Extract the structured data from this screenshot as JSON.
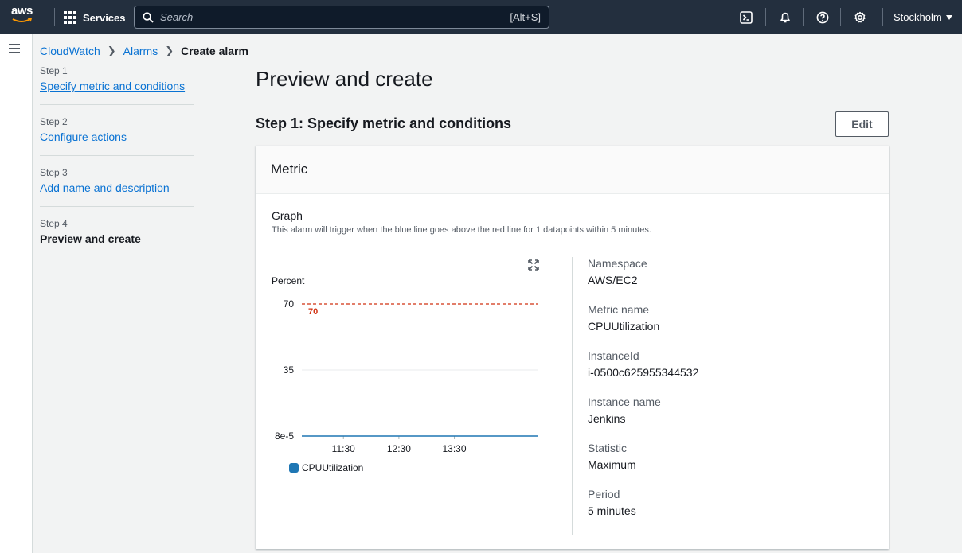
{
  "topnav": {
    "logo": "aws",
    "services_label": "Services",
    "search_placeholder": "Search",
    "search_shortcut": "[Alt+S]",
    "region": "Stockholm",
    "icons": [
      "cloudshell-icon",
      "notifications-icon",
      "help-icon",
      "settings-icon"
    ]
  },
  "breadcrumb": {
    "items": [
      "CloudWatch",
      "Alarms"
    ],
    "current": "Create alarm"
  },
  "steps": [
    {
      "number": "Step 1",
      "label": "Specify metric and conditions"
    },
    {
      "number": "Step 2",
      "label": "Configure actions"
    },
    {
      "number": "Step 3",
      "label": "Add name and description"
    },
    {
      "number": "Step 4",
      "label": "Preview and create"
    }
  ],
  "page": {
    "title": "Preview and create",
    "section_title": "Step 1: Specify metric and conditions",
    "edit_label": "Edit"
  },
  "metric_card": {
    "header": "Metric",
    "graph_label": "Graph",
    "graph_description": "This alarm will trigger when the blue line goes above the red line for 1 datapoints within 5 minutes."
  },
  "chart_data": {
    "type": "line",
    "ylabel": "Percent",
    "y_ticks": [
      "70",
      "35",
      "8e-5"
    ],
    "y_tick_values": [
      70,
      35,
      8e-05
    ],
    "ylim": [
      8e-05,
      70
    ],
    "x_ticks": [
      "11:30",
      "12:30",
      "13:30"
    ],
    "threshold": {
      "value": 70,
      "label": "70",
      "color": "#d13212"
    },
    "series": [
      {
        "name": "CPUUtilization",
        "color": "#1f77b4",
        "segments": [
          [
            [
              "10:45",
              8e-05
            ],
            [
              "10:50",
              8e-05
            ],
            [
              "10:55",
              8e-05
            ],
            [
              "11:00",
              8e-05
            ],
            [
              "11:05",
              8e-05
            ],
            [
              "11:10",
              8e-05
            ],
            [
              "11:15",
              8e-05
            ],
            [
              "11:20",
              8e-05
            ],
            [
              "11:25",
              8e-05
            ],
            [
              "11:30",
              8e-05
            ],
            [
              "11:35",
              8e-05
            ],
            [
              "11:40",
              8e-05
            ],
            [
              "11:45",
              8e-05
            ],
            [
              "11:50",
              8e-05
            ],
            [
              "11:55",
              8e-05
            ],
            [
              "12:00",
              8e-05
            ],
            [
              "12:05",
              8e-05
            ],
            [
              "12:10",
              8e-05
            ],
            [
              "12:15",
              8e-05
            ],
            [
              "12:20",
              8e-05
            ],
            [
              "12:25",
              8e-05
            ],
            [
              "12:30",
              8e-05
            ],
            [
              "12:35",
              8e-05
            ],
            [
              "12:40",
              8e-05
            ],
            [
              "12:45",
              8e-05
            ],
            [
              "12:50",
              8e-05
            ],
            [
              "12:55",
              8e-05
            ],
            [
              "13:00",
              8e-05
            ],
            [
              "13:05",
              8e-05
            ],
            [
              "13:10",
              8e-05
            ],
            [
              "13:15",
              8e-05
            ],
            [
              "13:20",
              8e-05
            ],
            [
              "13:25",
              8e-05
            ],
            [
              "13:30",
              8e-05
            ],
            [
              "13:35",
              8e-05
            ],
            [
              "13:40",
              8e-05
            ],
            [
              "13:45",
              8e-05
            ],
            [
              "13:50",
              8e-05
            ],
            [
              "13:55",
              8e-05
            ],
            [
              "14:00",
              8e-05
            ],
            [
              "14:05",
              8e-05
            ],
            [
              "14:10",
              8e-05
            ],
            [
              "14:15",
              8e-05
            ],
            [
              "14:20",
              8e-05
            ],
            [
              "14:25",
              8e-05
            ],
            [
              "14:30",
              8e-05
            ],
            [
              "14:35",
              8e-05
            ],
            [
              "14:40",
              8e-05
            ],
            [
              "14:45",
              8e-05
            ],
            [
              "14:50",
              8e-05
            ],
            [
              "14:55",
              8e-05
            ],
            [
              "15:00",
              8e-05
            ]
          ]
        ]
      }
    ],
    "legend": [
      "CPUUtilization"
    ]
  },
  "details": [
    {
      "label": "Namespace",
      "value": "AWS/EC2"
    },
    {
      "label": "Metric name",
      "value": "CPUUtilization"
    },
    {
      "label": "InstanceId",
      "value": "i-0500c625955344532"
    },
    {
      "label": "Instance name",
      "value": "Jenkins"
    },
    {
      "label": "Statistic",
      "value": "Maximum"
    },
    {
      "label": "Period",
      "value": "5 minutes"
    }
  ]
}
